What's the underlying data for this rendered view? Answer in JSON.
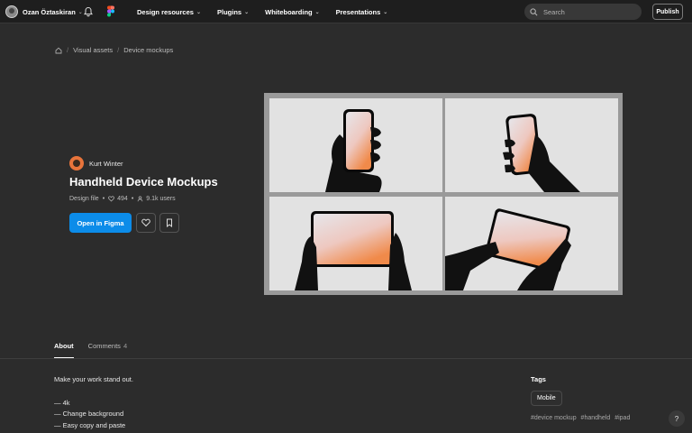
{
  "topbar": {
    "username": "Ozan Öztaskiran",
    "nav": [
      {
        "label": "Design resources"
      },
      {
        "label": "Plugins"
      },
      {
        "label": "Whiteboarding"
      },
      {
        "label": "Presentations"
      }
    ],
    "search_placeholder": "Search",
    "publish_label": "Publish"
  },
  "breadcrumb": {
    "items": [
      "Visual assets",
      "Device mockups"
    ]
  },
  "file": {
    "author": "Kurt Winter",
    "title": "Handheld Device Mockups",
    "type": "Design file",
    "likes": "494",
    "users": "9.1k users",
    "open_label": "Open in Figma"
  },
  "tabs": [
    {
      "label": "About",
      "count": ""
    },
    {
      "label": "Comments",
      "count": "4"
    }
  ],
  "about": {
    "tagline": "Make your work stand out.",
    "features": [
      "— 4k",
      "— Change background",
      "— Easy copy and paste"
    ]
  },
  "tags": {
    "title": "Tags",
    "chip": "Mobile",
    "hashtags": [
      "#device mockup",
      "#handheld",
      "#ipad"
    ]
  },
  "help_label": "?",
  "colors": {
    "accent": "#0c8ce9",
    "background": "#2c2c2c",
    "topbar": "#1e1e1e"
  }
}
